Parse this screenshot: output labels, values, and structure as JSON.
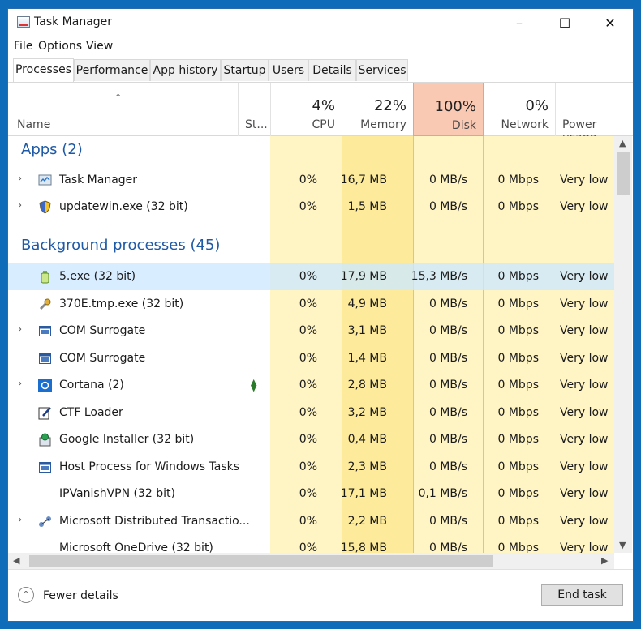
{
  "window": {
    "title": "Task Manager",
    "minimize": "–",
    "maximize": "☐",
    "close": "✕"
  },
  "menu": [
    "File",
    "Options",
    "View"
  ],
  "tabs": [
    "Processes",
    "Performance",
    "App history",
    "Startup",
    "Users",
    "Details",
    "Services"
  ],
  "active_tab": "Processes",
  "columns": {
    "name": "Name",
    "status": "St...",
    "cpu": {
      "percent": "4%",
      "label": "CPU"
    },
    "memory": {
      "percent": "22%",
      "label": "Memory"
    },
    "disk": {
      "percent": "100%",
      "label": "Disk"
    },
    "network": {
      "percent": "0%",
      "label": "Network"
    },
    "power": "Power usage"
  },
  "sort_indicator": "^",
  "groups": {
    "apps": "Apps (2)",
    "background": "Background processes (45)"
  },
  "apps": [
    {
      "name": "Task Manager",
      "cpu": "0%",
      "memory": "16,7 MB",
      "disk": "0 MB/s",
      "network": "0 Mbps",
      "power": "Very low",
      "expandable": true,
      "icon": "task-manager-icon"
    },
    {
      "name": "updatewin.exe (32 bit)",
      "cpu": "0%",
      "memory": "1,5 MB",
      "disk": "0 MB/s",
      "network": "0 Mbps",
      "power": "Very low",
      "expandable": true,
      "icon": "shield-icon"
    }
  ],
  "background": [
    {
      "name": "5.exe (32 bit)",
      "cpu": "0%",
      "memory": "17,9 MB",
      "disk": "15,3 MB/s",
      "network": "0 Mbps",
      "power": "Very low",
      "expandable": false,
      "icon": "bottle-icon",
      "selected": true
    },
    {
      "name": "370E.tmp.exe (32 bit)",
      "cpu": "0%",
      "memory": "4,9 MB",
      "disk": "0 MB/s",
      "network": "0 Mbps",
      "power": "Very low",
      "expandable": false,
      "icon": "wrench-icon"
    },
    {
      "name": "COM Surrogate",
      "cpu": "0%",
      "memory": "3,1 MB",
      "disk": "0 MB/s",
      "network": "0 Mbps",
      "power": "Very low",
      "expandable": true,
      "icon": "window-icon"
    },
    {
      "name": "COM Surrogate",
      "cpu": "0%",
      "memory": "1,4 MB",
      "disk": "0 MB/s",
      "network": "0 Mbps",
      "power": "Very low",
      "expandable": false,
      "icon": "window-icon"
    },
    {
      "name": "Cortana (2)",
      "cpu": "0%",
      "memory": "2,8 MB",
      "disk": "0 MB/s",
      "network": "0 Mbps",
      "power": "Very low",
      "expandable": true,
      "icon": "cortana-icon",
      "status_icon": "leaf-icon"
    },
    {
      "name": "CTF Loader",
      "cpu": "0%",
      "memory": "3,2 MB",
      "disk": "0 MB/s",
      "network": "0 Mbps",
      "power": "Very low",
      "expandable": false,
      "icon": "pen-icon"
    },
    {
      "name": "Google Installer (32 bit)",
      "cpu": "0%",
      "memory": "0,4 MB",
      "disk": "0 MB/s",
      "network": "0 Mbps",
      "power": "Very low",
      "expandable": false,
      "icon": "installer-icon"
    },
    {
      "name": "Host Process for Windows Tasks",
      "cpu": "0%",
      "memory": "2,3 MB",
      "disk": "0 MB/s",
      "network": "0 Mbps",
      "power": "Very low",
      "expandable": false,
      "icon": "window-icon"
    },
    {
      "name": "IPVanishVPN (32 bit)",
      "cpu": "0%",
      "memory": "17,1 MB",
      "disk": "0,1 MB/s",
      "network": "0 Mbps",
      "power": "Very low",
      "expandable": false,
      "icon": "blank-icon"
    },
    {
      "name": "Microsoft Distributed Transactio...",
      "cpu": "0%",
      "memory": "2,2 MB",
      "disk": "0 MB/s",
      "network": "0 Mbps",
      "power": "Very low",
      "expandable": true,
      "icon": "network-icon"
    },
    {
      "name": "Microsoft OneDrive (32 bit)",
      "cpu": "0%",
      "memory": "15,8 MB",
      "disk": "0 MB/s",
      "network": "0 Mbps",
      "power": "Very low",
      "expandable": false,
      "icon": "blank-icon"
    }
  ],
  "footer": {
    "fewer_details": "Fewer details",
    "fewer_icon": "^",
    "end_task": "End task"
  },
  "colors": {
    "cpu_bg": "#fff4c4",
    "memory_bg": "#fdeb9b",
    "disk_bg": "#fff4c4",
    "disk_header": "#f9c9b4",
    "selection": "#cde8ff",
    "group_text": "#1f5aa6"
  }
}
